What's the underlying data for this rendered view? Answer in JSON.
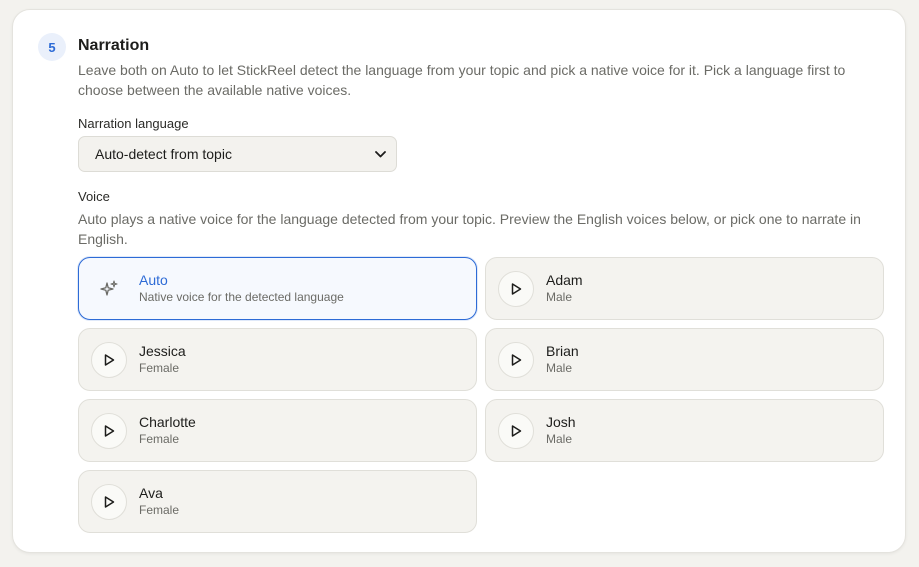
{
  "section": {
    "step": "5",
    "title": "Narration",
    "description": "Leave both on Auto to let StickReel detect the language from your topic and pick a native voice for it. Pick a language first to choose between the available native voices."
  },
  "language": {
    "label": "Narration language",
    "selected": "Auto-detect from topic"
  },
  "voice": {
    "label": "Voice",
    "description": "Auto plays a native voice for the language detected from your topic. Preview the English voices below, or pick one to narrate in English.",
    "options": [
      {
        "name": "Auto",
        "sub": "Native voice for the detected language",
        "icon": "sparkle-icon",
        "selected": true
      },
      {
        "name": "Adam",
        "sub": "Male",
        "icon": "play-icon",
        "selected": false
      },
      {
        "name": "Jessica",
        "sub": "Female",
        "icon": "play-icon",
        "selected": false
      },
      {
        "name": "Brian",
        "sub": "Male",
        "icon": "play-icon",
        "selected": false
      },
      {
        "name": "Charlotte",
        "sub": "Female",
        "icon": "play-icon",
        "selected": false
      },
      {
        "name": "Josh",
        "sub": "Male",
        "icon": "play-icon",
        "selected": false
      },
      {
        "name": "Ava",
        "sub": "Female",
        "icon": "play-icon",
        "selected": false
      }
    ]
  },
  "colors": {
    "accent": "#2d6bd6",
    "card_bg": "#ffffff",
    "page_bg": "#f3f2ee"
  }
}
